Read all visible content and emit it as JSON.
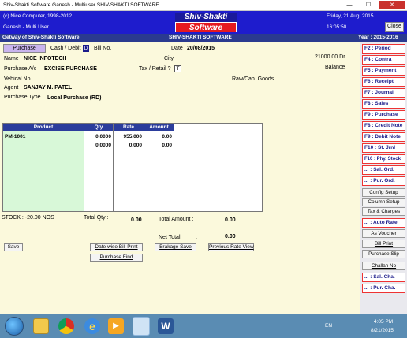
{
  "window": {
    "title": "Shiv-Shakti Software   Ganesh - Multiuser  SHIV-SHAKTI SOFTWARE",
    "min_label": "—",
    "max_label": "☐",
    "close_label": "✕"
  },
  "header": {
    "copyright": "(c) Nice Computer, 1998-2012",
    "user": "Ganesh - Multi User",
    "logo_top": "Shiv-Shakti",
    "logo_bottom": "Software",
    "date": "Friday, 21 Aug, 2015",
    "time": "16:05:50",
    "close_label": "Close"
  },
  "subbar": {
    "left": "Getway of Shiv-Shakti Software",
    "center": "SHIV-SHAKTI SOFTWARE",
    "right": "Year : 2015-2016"
  },
  "form": {
    "tab_label": "Purchase",
    "cash_debit_label": "Cash / Debit",
    "cash_debit_value": "D",
    "bill_no_label": "Bill No.",
    "date_label": "Date",
    "date_value": "20/08/2015",
    "name_label": "Name",
    "name_value": "NICE INFOTECH",
    "city_label": "City",
    "balance_value": "21000.00 Dr",
    "balance_label": "Balance",
    "purchase_ac_label": "Purchase A/c",
    "purchase_ac_value": "EXCISE PURCHASE",
    "tax_retail_label": "Tax / Retail ?",
    "tax_retail_value": "T",
    "vehical_label": "Vehical No.",
    "raw_cap_label": "Raw/Cap. Goods",
    "agent_label": "Agent",
    "agent_value": "SANJAY M. PATEL",
    "purchase_type_label": "Purchase Type",
    "purchase_type_value": "Local Purchase (RD)"
  },
  "grid": {
    "columns": [
      "Product",
      "Qty",
      "Rate",
      "Amount"
    ],
    "rows": [
      {
        "product": "PM-1001",
        "qty": "0.0000",
        "rate": "955.000",
        "amount": "0.00"
      },
      {
        "product": "",
        "qty": "0.0000",
        "rate": "0.000",
        "amount": "0.00"
      }
    ]
  },
  "totals": {
    "stock": "STOCK : -20.00 NOS",
    "total_qty_label": "Total Qty :",
    "total_qty_value": "0.00",
    "total_amount_label": "Total Amount :",
    "total_amount_value": "0.00",
    "net_total_label": "Net Total",
    "net_total_colon": ":",
    "net_total_value": "0.00"
  },
  "buttons": {
    "save": "Save",
    "date_wise_bill_print": "Date wise Bill Print",
    "purchase_find": "Purchase Find",
    "brakage_save": "Brakage Save",
    "previous_rate_view": "Previous Rate View"
  },
  "right_panel": {
    "fkeys": [
      {
        "key": "F2",
        "label": ": Period"
      },
      {
        "key": "F4",
        "label": ": Contra"
      },
      {
        "key": "F5",
        "label": ": Payment"
      },
      {
        "key": "F6",
        "label": ": Receipt"
      },
      {
        "key": "F7",
        "label": ": Journal"
      },
      {
        "key": "F8",
        "label": ": Sales"
      },
      {
        "key": "F9",
        "label": ": Purchase"
      },
      {
        "key": "F8",
        "label": ": Credit Note"
      },
      {
        "key": "F9",
        "label": ": Debit Note"
      },
      {
        "key": "F10",
        "label": ": St. Jrnl"
      },
      {
        "key": "F10",
        "label": ": Phy. Stock"
      },
      {
        "key": "...",
        "label": ": Sal. Ord."
      },
      {
        "key": "...",
        "label": ": Pur. Ord."
      }
    ],
    "config_setup": "Config Setup",
    "column_setup": "Column Setup",
    "tax_charges": "Tax & Charges",
    "auto_rate": {
      "key": "...",
      "label": ": Auto Rate"
    },
    "as_voucher": "As Voucher",
    "bill_print": "Bill Print",
    "purchase_slip": "Purchase Slip",
    "challan_no": "Challan No",
    "sal_cha": {
      "key": "...",
      "label": ": Sal. Cha."
    },
    "pur_cha": {
      "key": "...",
      "label": ": Pur. Cha."
    }
  },
  "taskbar": {
    "lang": "EN",
    "time": "4:05 PM",
    "date": "8/21/2015",
    "icons": [
      "start-orb-icon",
      "file-explorer-icon",
      "chrome-icon",
      "internet-explorer-icon",
      "media-player-icon",
      "shiv-shakti-app-icon",
      "word-icon"
    ]
  },
  "colors": {
    "header_blue": "#1e1ccd",
    "subbar": "#2a3a8f",
    "logo_red": "#e51920",
    "form_bg": "#fbf9dc",
    "product_cell_green": "#d8f8d8"
  }
}
